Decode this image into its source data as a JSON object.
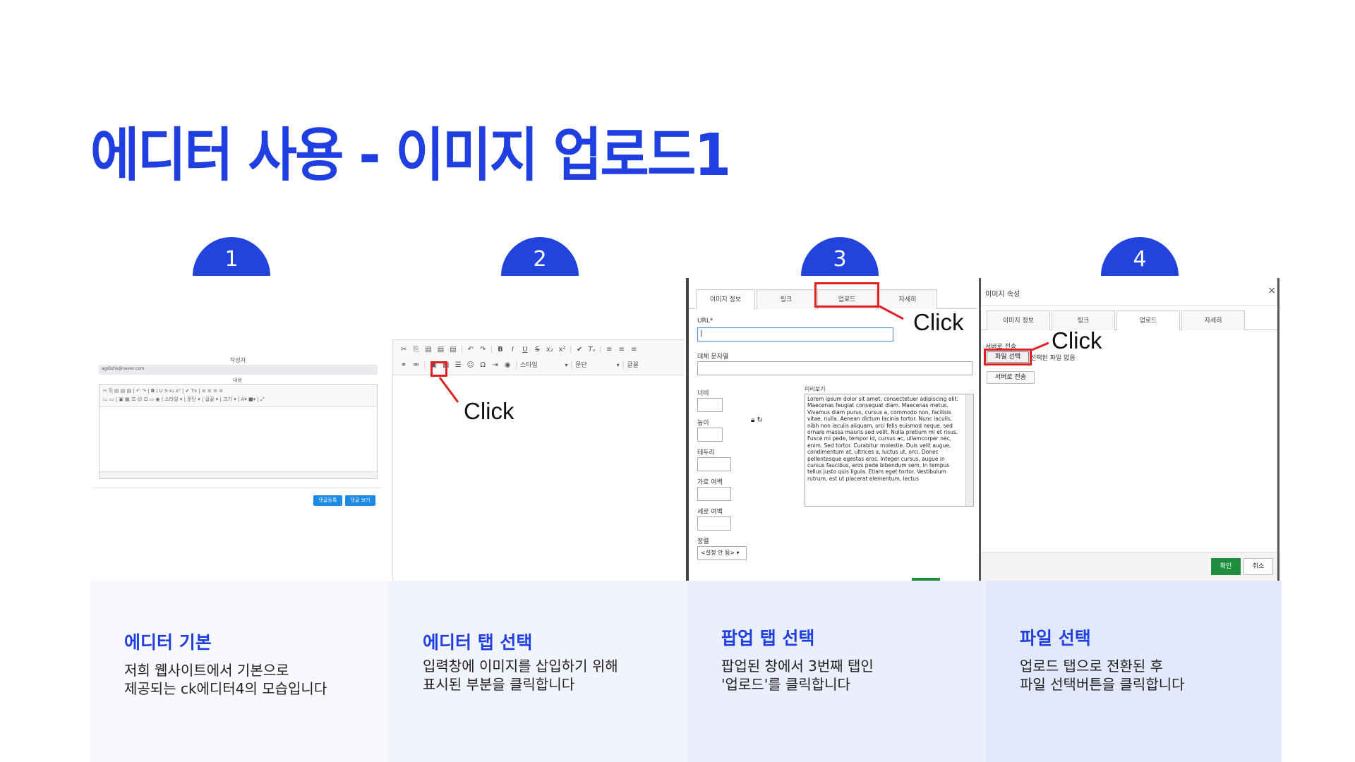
{
  "title": "에디터 사용 - 이미지 업로드1",
  "steps": [
    {
      "num": "1",
      "card_title": "에디터 기본",
      "desc1": "저희 웹사이트에서 기본으로",
      "desc2": "제공되는 ck에디터4의 모습입니다"
    },
    {
      "num": "2",
      "card_title": "에디터 탭 선택",
      "desc1": "입력창에 이미지를 삽입하기 위해",
      "desc2": "표시된 부분을 클릭합니다"
    },
    {
      "num": "3",
      "card_title": "팝업 탭 선택",
      "desc1": "팝업된 창에서 3번째 탭인",
      "desc2": "'업로드'를 클릭합니다"
    },
    {
      "num": "4",
      "card_title": "파일 선택",
      "desc1": "업로드 탭으로 전환된 후",
      "desc2": "파일 선택버튼을 클릭합니다"
    }
  ],
  "shot1": {
    "author_label": "작성자",
    "author_value": "agdistis@naver.com",
    "content_label": "내용",
    "style_select": "스타일",
    "para_select": "문단",
    "font_select": "글꼴",
    "size_select": "크기",
    "register_btn": "댓글등록",
    "view_btn": "댓글 보기"
  },
  "shot2": {
    "style_select": "스타일",
    "para_select": "문단",
    "font_select": "글꼴",
    "click": "Click"
  },
  "shot3": {
    "tabs": [
      "이미지 정보",
      "링크",
      "업로드",
      "자세히"
    ],
    "url_label": "URL*",
    "alt_label": "대체 문자열",
    "width_label": "너비",
    "height_label": "높이",
    "border_label": "테두리",
    "hspace_label": "가로 여백",
    "vspace_label": "세로 여백",
    "align_label": "정렬",
    "align_value": "<설정 안 됨>",
    "preview_label": "미리보기",
    "preview_text": "Lorem ipsum dolor sit amet, consectetuer adipiscing elit. Maecenas feugiat consequat diam. Maecenas metus. Vivamus diam purus, cursus a, commodo non, facilisis vitae, nulla. Aenean dictum lacinia tortor. Nunc iaculis, nibh non iaculis aliquam, orci felis euismod neque, sed ornare massa mauris sed velit. Nulla pretium mi et risus. Fusce mi pede, tempor id, cursus ac, ullamcorper nec, enim. Sed tortor. Curabitur molestie. Duis velit augue, condimentum at, ultrices a, luctus ut, orci. Donec pellentesque egestas eros. Integer cursus, augue in cursus faucibus, eros pede bibendum sem, in tempus tellus justo quis ligula. Etiam eget tortor. Vestibulum rutrum, est ut placerat elementum, lectus",
    "click": "Click"
  },
  "shot4": {
    "dialog_title": "이미지 속성",
    "close": "×",
    "tabs": [
      "이미지 정보",
      "링크",
      "업로드",
      "자세히"
    ],
    "send_label": "서버로 전송",
    "file_btn": "파일 선택",
    "no_file": "선택된 파일 없음",
    "send_btn": "서버로 전송",
    "ok_btn": "확인",
    "cancel_btn": "취소",
    "click": "Click"
  },
  "colors": {
    "accent": "#1f3fe0",
    "badge": "#2244dd",
    "highlight": "#e02020",
    "ok_green": "#1e8e3e"
  }
}
